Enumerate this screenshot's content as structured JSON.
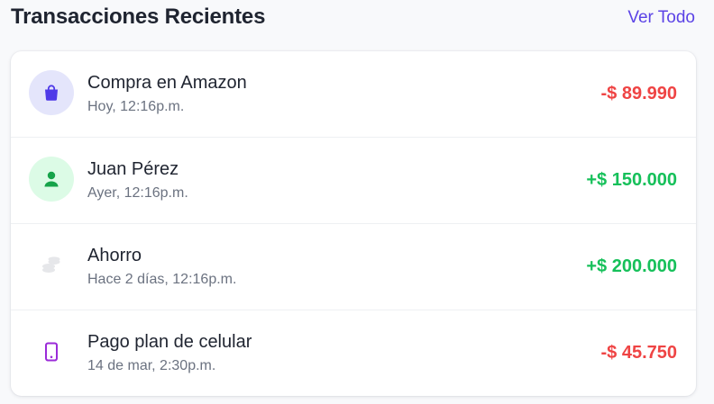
{
  "header": {
    "title": "Transacciones Recientes",
    "see_all_label": "Ver Todo"
  },
  "colors": {
    "accent": "#5b43e6",
    "negative": "#ef4444",
    "positive": "#16c05a"
  },
  "transactions": [
    {
      "name": "Compra en Amazon",
      "time": "Hoy, 12:16p.m.",
      "amount": "-$ 89.990",
      "kind": "negative",
      "icon": "shopping-bag-icon",
      "icon_bg": "#e4e5fb",
      "icon_color": "#4f3ae8"
    },
    {
      "name": "Juan Pérez",
      "time": "Ayer, 12:16p.m.",
      "amount": "+$ 150.000",
      "kind": "positive",
      "icon": "user-icon",
      "icon_bg": "#dcfbe6",
      "icon_color": "#16a34a"
    },
    {
      "name": "Ahorro",
      "time": "Hace 2 días, 12:16p.m.",
      "amount": "+$ 200.000",
      "kind": "positive",
      "icon": "coins-icon",
      "icon_bg": "#ffffff",
      "icon_color": "#e6e7ea"
    },
    {
      "name": "Pago plan de celular",
      "time": "14 de mar, 2:30p.m.",
      "amount": "-$ 45.750",
      "kind": "negative",
      "icon": "mobile-phone-icon",
      "icon_bg": "#ffffff",
      "icon_color": "#9b2bd8"
    }
  ]
}
